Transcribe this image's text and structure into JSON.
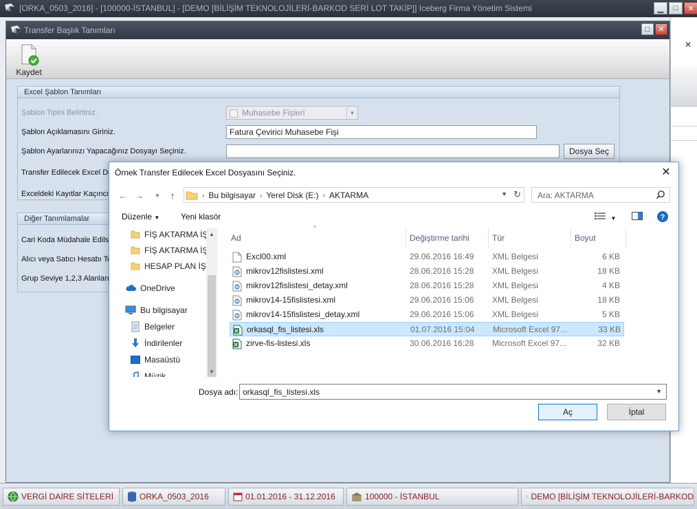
{
  "app": {
    "title": "[ORKA_0503_2016]  -  [100000-İSTANBUL]  -  [DEMO [BİLİŞİM TEKNOLOJİLERİ-BARKOD SERİ LOT TAKİP]]      Iceberg Firma Yönetim Sistemi"
  },
  "transfer_window": {
    "title": "Transfer Başlık Tanımları",
    "toolbar": {
      "save_label": "Kaydet"
    },
    "excel_group": {
      "header": "Excel Şablon Tanımları",
      "template_type_label": "Şablon Tipini Belirtiniz.",
      "template_type_value": "Muhasebe Fişleri",
      "template_desc_label": "Şablon Açıklamasını Giriniz.",
      "template_desc_value": "Fatura Çevirici Muhasebe Fişi",
      "settings_file_label": "Şablon Ayarlarınızı Yapacağınız Dosyayı Seçiniz.",
      "settings_file_value": "",
      "choose_file_button": "Dosya Seç",
      "transfer_excel_label": "Transfer Edilecek Excel Dos",
      "record_row_label": "Exceldeki Kayıtlar Kaçıncı Si"
    },
    "other_group": {
      "header": "Diğer Tanımlamalar",
      "row1_label": "Cari Koda Müdahale Edilsin",
      "row2_label": "Alıcı veya Satıcı Hesabı Tek",
      "row3_label": "Grup Seviye 1,2,3 Alanları"
    }
  },
  "dialog": {
    "title": "Örnek Transfer Edilecek Excel Dosyasını Seçiniz.",
    "breadcrumb": [
      "Bu bilgisayar",
      "Yerel Disk (E:)",
      "AKTARMA"
    ],
    "search_placeholder": "Ara: AKTARMA",
    "organize_label": "Düzenle",
    "new_folder_label": "Yeni klasör",
    "tree": [
      {
        "label": "FİŞ AKTARMA İŞ",
        "icon": "folder-icon"
      },
      {
        "label": "FİŞ AKTARMA İŞ",
        "icon": "folder-icon"
      },
      {
        "label": "HESAP PLAN İŞL",
        "icon": "folder-icon"
      },
      {
        "label": "OneDrive",
        "icon": "cloud-icon"
      },
      {
        "label": "Bu bilgisayar",
        "icon": "computer-icon"
      },
      {
        "label": "Belgeler",
        "icon": "documents-icon"
      },
      {
        "label": "İndirilenler",
        "icon": "download-icon"
      },
      {
        "label": "Masaüstü",
        "icon": "desktop-icon"
      },
      {
        "label": "Müzik",
        "icon": "music-icon"
      }
    ],
    "columns": {
      "name": "Ad",
      "modified": "Değiştirme tarihi",
      "type": "Tür",
      "size": "Boyut"
    },
    "files": [
      {
        "name": "Excl00.xml",
        "modified": "29.06.2016 16:49",
        "type": "XML Belgesi",
        "size": "6 KB",
        "icon": "file-icon"
      },
      {
        "name": "mikrov12fislistesi.xml",
        "modified": "28.06.2016 15:28",
        "type": "XML Belgesi",
        "size": "18 KB",
        "icon": "xml-file-icon"
      },
      {
        "name": "mikrov12fislistesi_detay.xml",
        "modified": "28.06.2016 15:28",
        "type": "XML Belgesi",
        "size": "4 KB",
        "icon": "xml-file-icon"
      },
      {
        "name": "mikrov14-15fislistesi.xml",
        "modified": "29.06.2016 15:06",
        "type": "XML Belgesi",
        "size": "18 KB",
        "icon": "xml-file-icon"
      },
      {
        "name": "mikrov14-15fislistesi_detay.xml",
        "modified": "29.06.2016 15:06",
        "type": "XML Belgesi",
        "size": "5 KB",
        "icon": "xml-file-icon"
      },
      {
        "name": "orkasql_fis_listesi.xls",
        "modified": "01.07.2016 15:04",
        "type": "Microsoft Excel 97...",
        "size": "33 KB",
        "icon": "excel-file-icon",
        "selected": true
      },
      {
        "name": "zirve-fis-listesi.xls",
        "modified": "30.06.2016 16:28",
        "type": "Microsoft Excel 97...",
        "size": "32 KB",
        "icon": "excel-file-icon"
      }
    ],
    "filename_label": "Dosya adı:",
    "filename_value": "orkasql_fis_listesi.xls",
    "open_button": "Aç",
    "cancel_button": "İptal"
  },
  "statusbar": {
    "items": [
      {
        "label": "VERGİ DAİRE SİTELERİ",
        "icon": "globe-icon"
      },
      {
        "label": "ORKA_0503_2016",
        "icon": "database-icon"
      },
      {
        "label": "01.01.2016 - 31.12.2016",
        "icon": "calendar-icon"
      },
      {
        "label": "100000 - İSTANBUL",
        "icon": "building-icon"
      },
      {
        "label": "DEMO [BİLİŞİM TEKNOLOJİLERİ-BARKOD",
        "icon": "document-edit-icon"
      }
    ]
  },
  "colors": {
    "accent": "#0078d7",
    "selection": "#cce8ff",
    "status_text": "#8b1a1a",
    "panel_bg": "#d7e1ee"
  }
}
